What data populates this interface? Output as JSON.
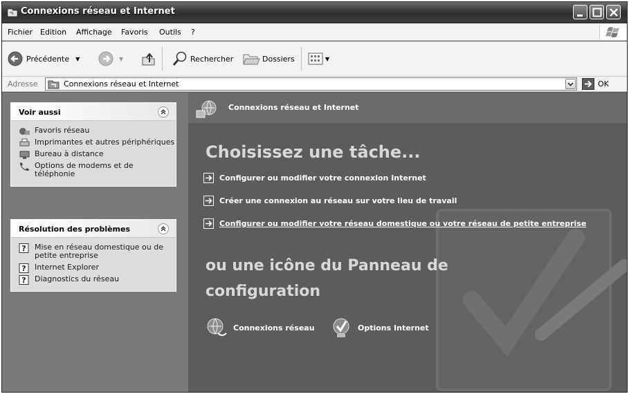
{
  "window": {
    "title": "Connexions réseau et Internet"
  },
  "menu": [
    "Fichier",
    "Edition",
    "Affichage",
    "Favoris",
    "Outils",
    "?"
  ],
  "toolbar": {
    "back_label": "Précédente",
    "search_label": "Rechercher",
    "folders_label": "Dossiers"
  },
  "address": {
    "label": "Adresse",
    "value": "Connexions réseau et Internet",
    "go_label": "OK"
  },
  "see_also": {
    "title": "Voir aussi",
    "items": [
      "Favoris réseau",
      "Imprimantes et autres périphériques",
      "Bureau à distance",
      "Options de modems et de téléphonie"
    ]
  },
  "troubleshoot": {
    "title": "Résolution des problèmes",
    "items": [
      "Mise en réseau domestique ou de petite entreprise",
      "Internet Explorer",
      "Diagnostics du réseau"
    ]
  },
  "content": {
    "header_title": "Connexions réseau et Internet",
    "pick_task": "Choisissez une tâche...",
    "tasks": [
      "Configurer ou modifier votre connexion Internet",
      "Créer une connexion au réseau sur votre lieu de travail",
      "Configurer ou modifier votre réseau domestique ou votre réseau de petite entreprise"
    ],
    "or_icon_line1": "ou une icône du Panneau de",
    "or_icon_line2": "configuration",
    "icons": [
      "Connexions réseau",
      "Options Internet"
    ]
  }
}
